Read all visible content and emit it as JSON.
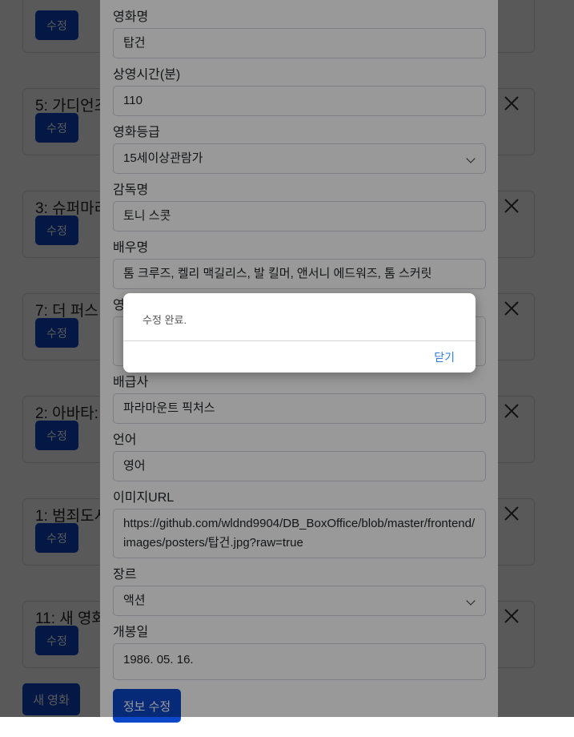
{
  "cards": [
    {
      "title": "",
      "edit_label": "수정"
    },
    {
      "title": "5: 가디언즈",
      "edit_label": "수정"
    },
    {
      "title": "3: 슈퍼마리",
      "edit_label": "수정"
    },
    {
      "title": "7: 더 퍼스",
      "edit_label": "수정"
    },
    {
      "title": "2: 아바타:",
      "edit_label": "수정"
    },
    {
      "title": "1: 범죄도시",
      "edit_label": "수정"
    },
    {
      "title": "11: 새 영화",
      "edit_label": "수정"
    }
  ],
  "new_movie_label": "새 영화",
  "form": {
    "title_label": "영화명",
    "title_value": "탑건",
    "runtime_label": "상영시간(분)",
    "runtime_value": "110",
    "rating_label": "영화등급",
    "rating_value": "15세이상관람가",
    "director_label": "감독명",
    "director_value": "토니 스콧",
    "actors_label": "배우명",
    "actors_value": "톰 크루즈, 켈리 맥길리스, 발 킬머, 앤서니 에드워즈, 톰 스커릿",
    "hidden_label": "영",
    "distributor_label": "배급사",
    "distributor_value": "파라마운트 픽처스",
    "language_label": "언어",
    "language_value": "영어",
    "image_label": "이미지URL",
    "image_value": "https://github.com/wldnd9904/DB_BoxOffice/blob/master/frontend/images/posters/탑건.jpg?raw=true",
    "genre_label": "장르",
    "genre_value": "액션",
    "release_label": "개봉일",
    "release_value": "1986. 05. 16.",
    "submit_label": "정보 수정"
  },
  "alert": {
    "message": "수정 완료.",
    "close_label": "닫기"
  },
  "colors": {
    "primary": "#0d47c9",
    "link": "#2f7de1"
  }
}
